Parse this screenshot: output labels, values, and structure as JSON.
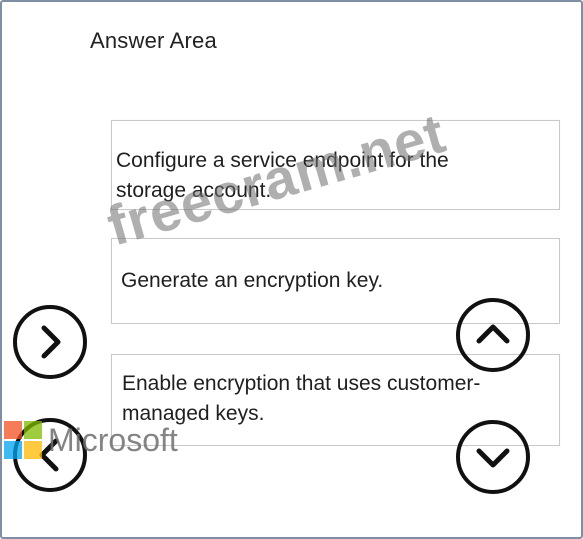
{
  "answer_area": {
    "title": "Answer Area"
  },
  "cards": [
    {
      "line1": "Configure a service endpoint for the",
      "line2": "storage account."
    },
    {
      "line1": "Generate an encryption key.",
      "line2": ""
    },
    {
      "line1": "Enable encryption that uses customer-",
      "line2": "managed keys."
    }
  ],
  "controls": {
    "move_right_icon": "chevron-right-icon",
    "move_left_icon": "chevron-left-icon",
    "move_up_icon": "chevron-up-icon",
    "move_down_icon": "chevron-down-icon"
  },
  "watermark": {
    "text": "freecram.net",
    "brand": "Microsoft"
  },
  "colors": {
    "frame_border": "#7f8fa3",
    "card_border": "#c9c9c9",
    "icon_stroke": "#111111"
  }
}
